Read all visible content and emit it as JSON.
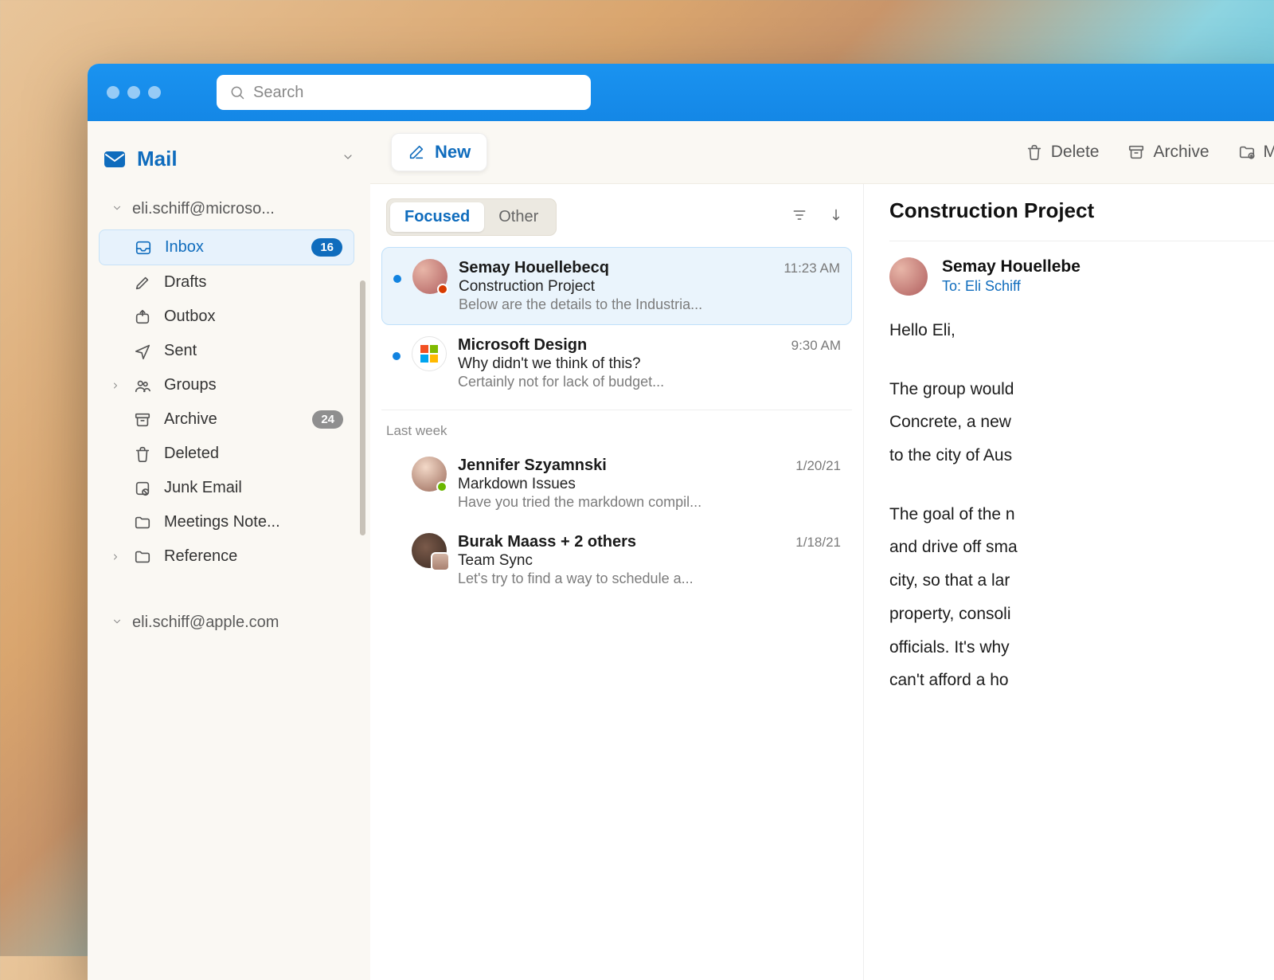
{
  "search": {
    "placeholder": "Search"
  },
  "sidebar": {
    "mail_label": "Mail",
    "accounts": [
      {
        "label": "eli.schiff@microso..."
      },
      {
        "label": "eli.schiff@apple.com"
      }
    ],
    "folders": [
      {
        "icon": "inbox",
        "label": "Inbox",
        "badge": "16",
        "selected": true
      },
      {
        "icon": "drafts",
        "label": "Drafts"
      },
      {
        "icon": "outbox",
        "label": "Outbox"
      },
      {
        "icon": "sent",
        "label": "Sent"
      },
      {
        "icon": "groups",
        "label": "Groups",
        "expandable": true
      },
      {
        "icon": "archive",
        "label": "Archive",
        "badge": "24",
        "muted": true
      },
      {
        "icon": "deleted",
        "label": "Deleted"
      },
      {
        "icon": "junk",
        "label": "Junk Email"
      },
      {
        "icon": "folder",
        "label": "Meetings Note..."
      },
      {
        "icon": "folder",
        "label": "Reference",
        "expandable": true
      }
    ]
  },
  "toolbar": {
    "new_label": "New",
    "delete_label": "Delete",
    "archive_label": "Archive",
    "move_label": "M"
  },
  "list": {
    "tabs": {
      "focused": "Focused",
      "other": "Other"
    },
    "section_last_week": "Last week",
    "items": [
      {
        "from": "Semay Houellebecq",
        "time": "11:23 AM",
        "subject": "Construction Project",
        "preview": "Below are the details to the Industria...",
        "unread": true,
        "avatar": "av1",
        "presence": "#d83b01",
        "selected": true
      },
      {
        "from": "Microsoft Design",
        "time": "9:30 AM",
        "subject": "Why didn't we think of this?",
        "preview": "Certainly not for lack of budget...",
        "unread": true,
        "avatar": "ms"
      },
      {
        "from": "Jennifer Szyamnski",
        "time": "1/20/21",
        "subject": "Markdown Issues",
        "preview": "Have you tried the markdown compil...",
        "avatar": "av3",
        "presence": "#6bb700"
      },
      {
        "from": "Burak Maass + 2 others",
        "time": "1/18/21",
        "subject": "Team Sync",
        "preview": "Let's try to find a way to schedule a...",
        "avatar": "av4"
      }
    ]
  },
  "reader": {
    "subject": "Construction Project",
    "from": "Semay Houellebe",
    "to": "To: Eli Schiff",
    "p1": "Hello Eli,",
    "p2": "The group would",
    "p3": "Concrete, a new",
    "p4": "to the city of Aus",
    "p5": "The goal of the n",
    "p6": "and drive off sma",
    "p7": "city, so that a lar",
    "p8": "property, consoli",
    "p9": "officials. It's why",
    "p10": "can't afford a ho"
  }
}
